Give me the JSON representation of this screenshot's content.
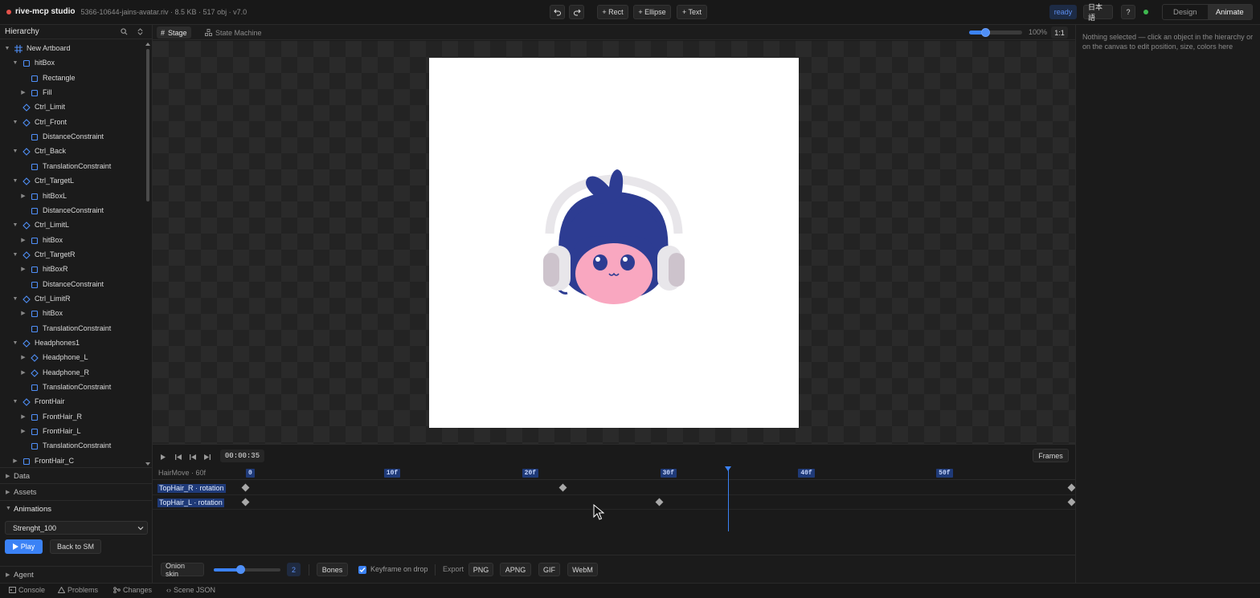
{
  "app": {
    "name": "rive-mcp studio",
    "file_meta": "5366-10644-jains-avatar.riv · 8.5 KB · 517 obj · v7.0"
  },
  "toolbar": {
    "undo_icon": "undo-icon",
    "redo_icon": "redo-icon",
    "add_rect": "+ Rect",
    "add_ellipse": "+ Ellipse",
    "add_text": "+ Text",
    "status": "ready",
    "language": "日本語",
    "help": "?",
    "mode_design": "Design",
    "mode_animate": "Animate",
    "active_mode": "Animate"
  },
  "hierarchy": {
    "title": "Hierarchy",
    "items": [
      {
        "label": "New Artboard",
        "depth": 0,
        "expand": "open",
        "icon": "artboard"
      },
      {
        "label": "hitBox",
        "depth": 1,
        "expand": "open",
        "icon": "square"
      },
      {
        "label": "Rectangle",
        "depth": 2,
        "expand": "none",
        "icon": "square"
      },
      {
        "label": "Fill",
        "depth": 2,
        "expand": "closed",
        "icon": "square"
      },
      {
        "label": "Ctrl_Limit",
        "depth": 1,
        "expand": "none",
        "icon": "diamond"
      },
      {
        "label": "Ctrl_Front",
        "depth": 1,
        "expand": "open",
        "icon": "diamond"
      },
      {
        "label": "DistanceConstraint",
        "depth": 2,
        "expand": "none",
        "icon": "square"
      },
      {
        "label": "Ctrl_Back",
        "depth": 1,
        "expand": "open",
        "icon": "diamond"
      },
      {
        "label": "TranslationConstraint",
        "depth": 2,
        "expand": "none",
        "icon": "square"
      },
      {
        "label": "Ctrl_TargetL",
        "depth": 1,
        "expand": "open",
        "icon": "diamond"
      },
      {
        "label": "hitBoxL",
        "depth": 2,
        "expand": "closed",
        "icon": "square"
      },
      {
        "label": "DistanceConstraint",
        "depth": 2,
        "expand": "none",
        "icon": "square"
      },
      {
        "label": "Ctrl_LimitL",
        "depth": 1,
        "expand": "open",
        "icon": "diamond"
      },
      {
        "label": "hitBox",
        "depth": 2,
        "expand": "closed",
        "icon": "square"
      },
      {
        "label": "Ctrl_TargetR",
        "depth": 1,
        "expand": "open",
        "icon": "diamond"
      },
      {
        "label": "hitBoxR",
        "depth": 2,
        "expand": "closed",
        "icon": "square"
      },
      {
        "label": "DistanceConstraint",
        "depth": 2,
        "expand": "none",
        "icon": "square"
      },
      {
        "label": "Ctrl_LimitR",
        "depth": 1,
        "expand": "open",
        "icon": "diamond"
      },
      {
        "label": "hitBox",
        "depth": 2,
        "expand": "closed",
        "icon": "square"
      },
      {
        "label": "TranslationConstraint",
        "depth": 2,
        "expand": "none",
        "icon": "square"
      },
      {
        "label": "Headphones1",
        "depth": 1,
        "expand": "open",
        "icon": "diamond"
      },
      {
        "label": "Headphone_L",
        "depth": 2,
        "expand": "closed",
        "icon": "diamond"
      },
      {
        "label": "Headphone_R",
        "depth": 2,
        "expand": "closed",
        "icon": "diamond"
      },
      {
        "label": "TranslationConstraint",
        "depth": 2,
        "expand": "none",
        "icon": "square"
      },
      {
        "label": "FrontHair",
        "depth": 1,
        "expand": "open",
        "icon": "diamond"
      },
      {
        "label": "FrontHair_R",
        "depth": 2,
        "expand": "closed",
        "icon": "square"
      },
      {
        "label": "FrontHair_L",
        "depth": 2,
        "expand": "closed",
        "icon": "square"
      },
      {
        "label": "TranslationConstraint",
        "depth": 2,
        "expand": "none",
        "icon": "square"
      },
      {
        "label": "FrontHair_C",
        "depth": 1,
        "expand": "closed",
        "icon": "square"
      }
    ]
  },
  "panels": {
    "data": "Data",
    "assets": "Assets",
    "animations": "Animations",
    "agent": "Agent"
  },
  "animations": {
    "selected": "Strenght_100",
    "play": "Play",
    "back": "Back to SM"
  },
  "stage": {
    "tab_stage": "Stage",
    "tab_state_machine": "State Machine",
    "zoom": "100%",
    "zoom_level": 0.3,
    "one_to_one": "1:1"
  },
  "timeline": {
    "timecode": "00:00:35",
    "frames_button": "Frames",
    "animation_label": "HairMove · 60f",
    "total_frames": 60,
    "playhead_frame": 35,
    "ticks": [
      "0",
      "10f",
      "20f",
      "30f",
      "40f",
      "50f"
    ],
    "tracks": [
      {
        "label": "TopHair_R · rotation",
        "keyframes": [
          0,
          23,
          60
        ]
      },
      {
        "label": "TopHair_L · rotation",
        "keyframes": [
          0,
          30,
          60
        ]
      }
    ]
  },
  "bottom_bar": {
    "onion_skin": "Onion skin",
    "onion_value": "2",
    "onion_level": 0.4,
    "bones": "Bones",
    "keyframe_on_drop": "Keyframe on drop",
    "keyframe_checked": true,
    "export_label": "Export",
    "png": "PNG",
    "apng": "APNG",
    "gif": "GIF",
    "webm": "WebM"
  },
  "inspector": {
    "empty_message": "Nothing selected — click an object in the hierarchy or on the canvas to edit position, size, colors here"
  },
  "status_bar": {
    "console": "Console",
    "problems": "Problems",
    "changes": "Changes",
    "scene_json": "Scene JSON"
  },
  "colors": {
    "accent": "#3b82f6",
    "ready_green": "#3fb950",
    "brand_dot": "#e5534b",
    "hair": "#2d3c92",
    "face": "#f9a7c0",
    "headphone": "#e4e0e4"
  }
}
